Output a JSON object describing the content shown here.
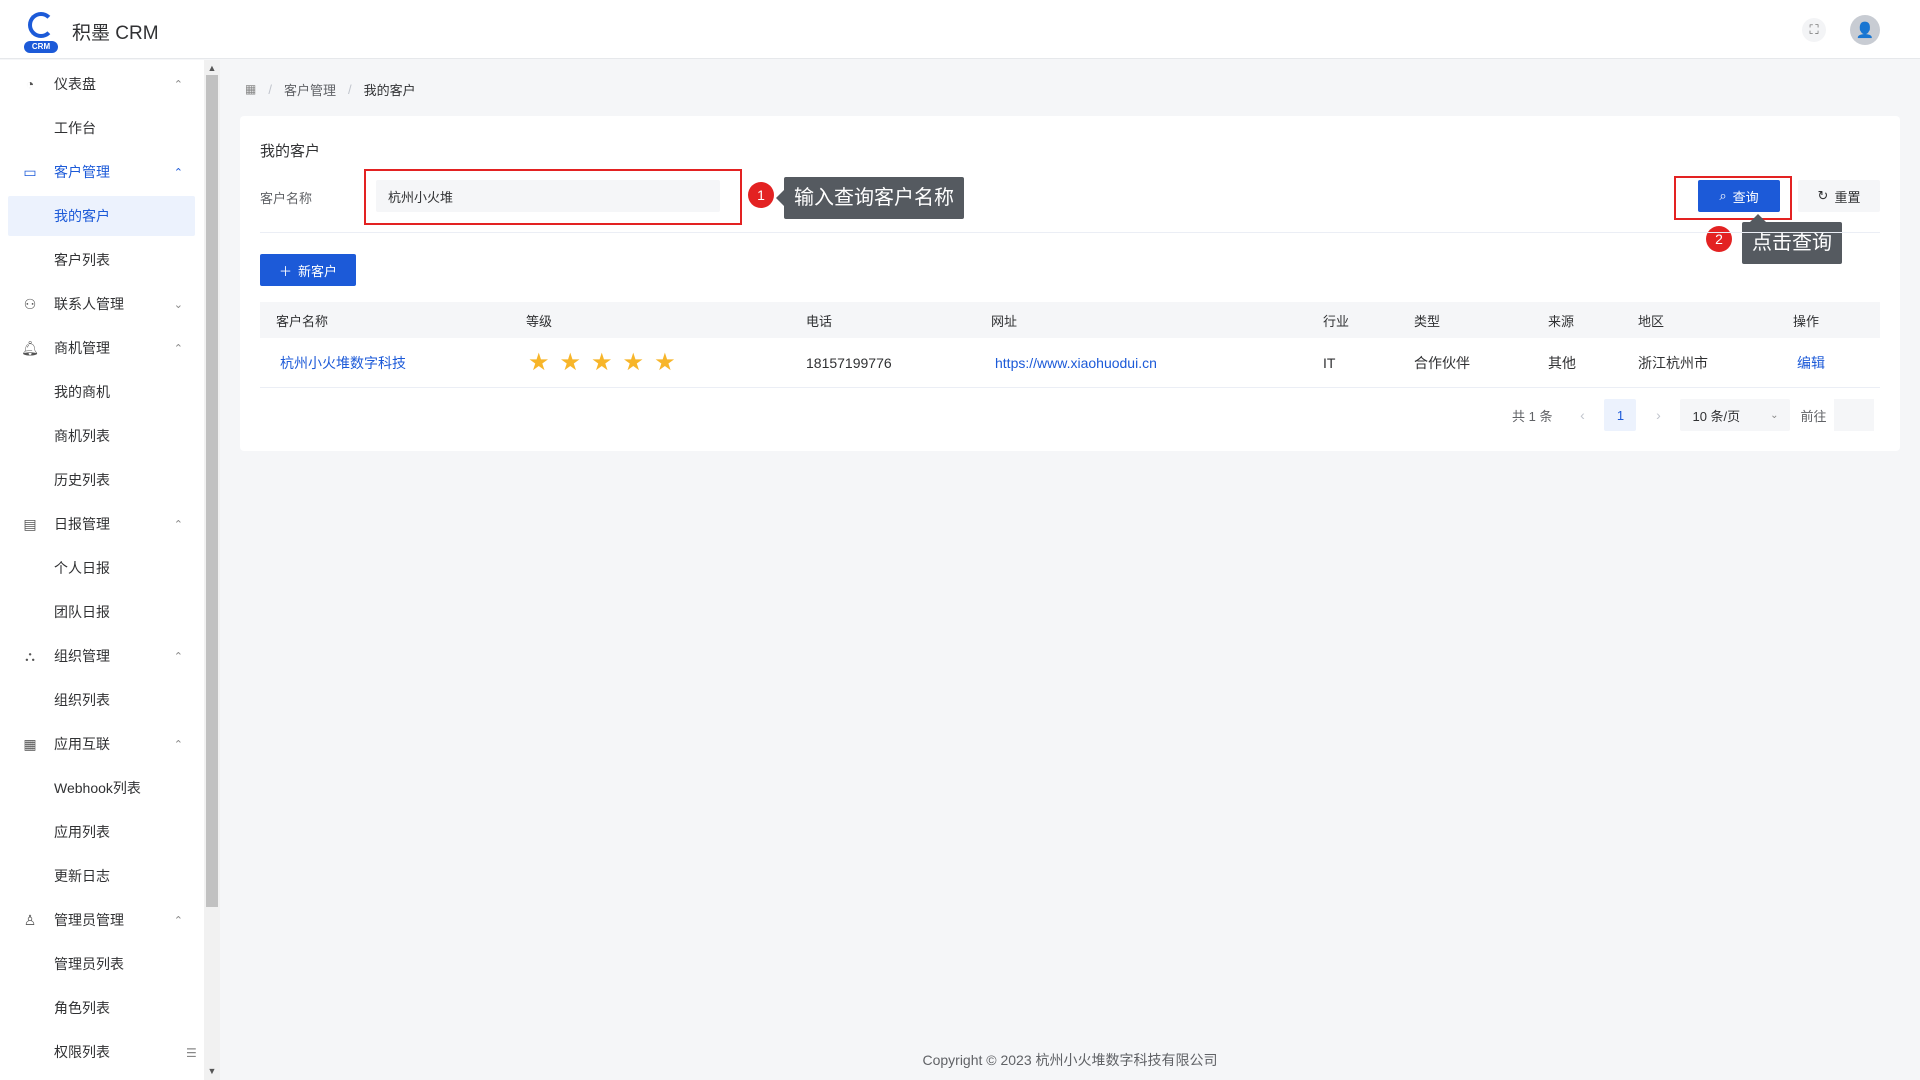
{
  "app": {
    "title": "积墨 CRM",
    "logo_tag": "CRM"
  },
  "sidebar": {
    "items": [
      {
        "label": "仪表盘",
        "icon": "dashboard-icon",
        "type": "group"
      },
      {
        "label": "工作台",
        "type": "sub"
      },
      {
        "label": "客户管理",
        "icon": "customer-box-icon",
        "type": "group",
        "active": true
      },
      {
        "label": "我的客户",
        "type": "sub",
        "selected": true
      },
      {
        "label": "客户列表",
        "type": "sub"
      },
      {
        "label": "联系人管理",
        "icon": "contacts-icon",
        "type": "group",
        "collapsed": true
      },
      {
        "label": "商机管理",
        "icon": "bell-icon",
        "type": "group"
      },
      {
        "label": "我的商机",
        "type": "sub"
      },
      {
        "label": "商机列表",
        "type": "sub"
      },
      {
        "label": "历史列表",
        "type": "sub"
      },
      {
        "label": "日报管理",
        "icon": "calendar-icon",
        "type": "group"
      },
      {
        "label": "个人日报",
        "type": "sub"
      },
      {
        "label": "团队日报",
        "type": "sub"
      },
      {
        "label": "组织管理",
        "icon": "organization-icon",
        "type": "group"
      },
      {
        "label": "组织列表",
        "type": "sub"
      },
      {
        "label": "应用互联",
        "icon": "apps-grid-icon",
        "type": "group"
      },
      {
        "label": "Webhook列表",
        "type": "sub"
      },
      {
        "label": "应用列表",
        "type": "sub"
      },
      {
        "label": "更新日志",
        "type": "sub"
      },
      {
        "label": "管理员管理",
        "icon": "user-icon",
        "type": "group"
      },
      {
        "label": "管理员列表",
        "type": "sub"
      },
      {
        "label": "角色列表",
        "type": "sub"
      },
      {
        "label": "权限列表",
        "type": "sub"
      }
    ]
  },
  "breadcrumb": {
    "items": [
      "客户管理",
      "我的客户"
    ]
  },
  "card": {
    "title": "我的客户"
  },
  "filter": {
    "label": "客户名称",
    "value": "杭州小火堆",
    "query_label": "查询",
    "reset_label": "重置"
  },
  "annotations": {
    "step1_num": "1",
    "step1_tip": "输入查询客户名称",
    "step2_num": "2",
    "step2_tip": "点击查询"
  },
  "new_button_label": "新客户",
  "table": {
    "headers": [
      "客户名称",
      "等级",
      "电话",
      "网址",
      "行业",
      "类型",
      "来源",
      "地区",
      "操作"
    ],
    "rows": [
      {
        "name": "杭州小火堆数字科技",
        "level": 5,
        "phone": "18157199776",
        "url": "https://www.xiaohuodui.cn",
        "industry": "IT",
        "type": "合作伙伴",
        "source": "其他",
        "region": "浙江杭州市",
        "action": "编辑"
      }
    ]
  },
  "pagination": {
    "total": "共 1 条",
    "current": "1",
    "page_size": "10 条/页",
    "goto": "前往"
  },
  "footer": "Copyright © 2023 杭州小火堆数字科技有限公司",
  "colors": {
    "primary": "#1c5ad8",
    "annotation": "#e32222",
    "star": "#f7b529"
  }
}
